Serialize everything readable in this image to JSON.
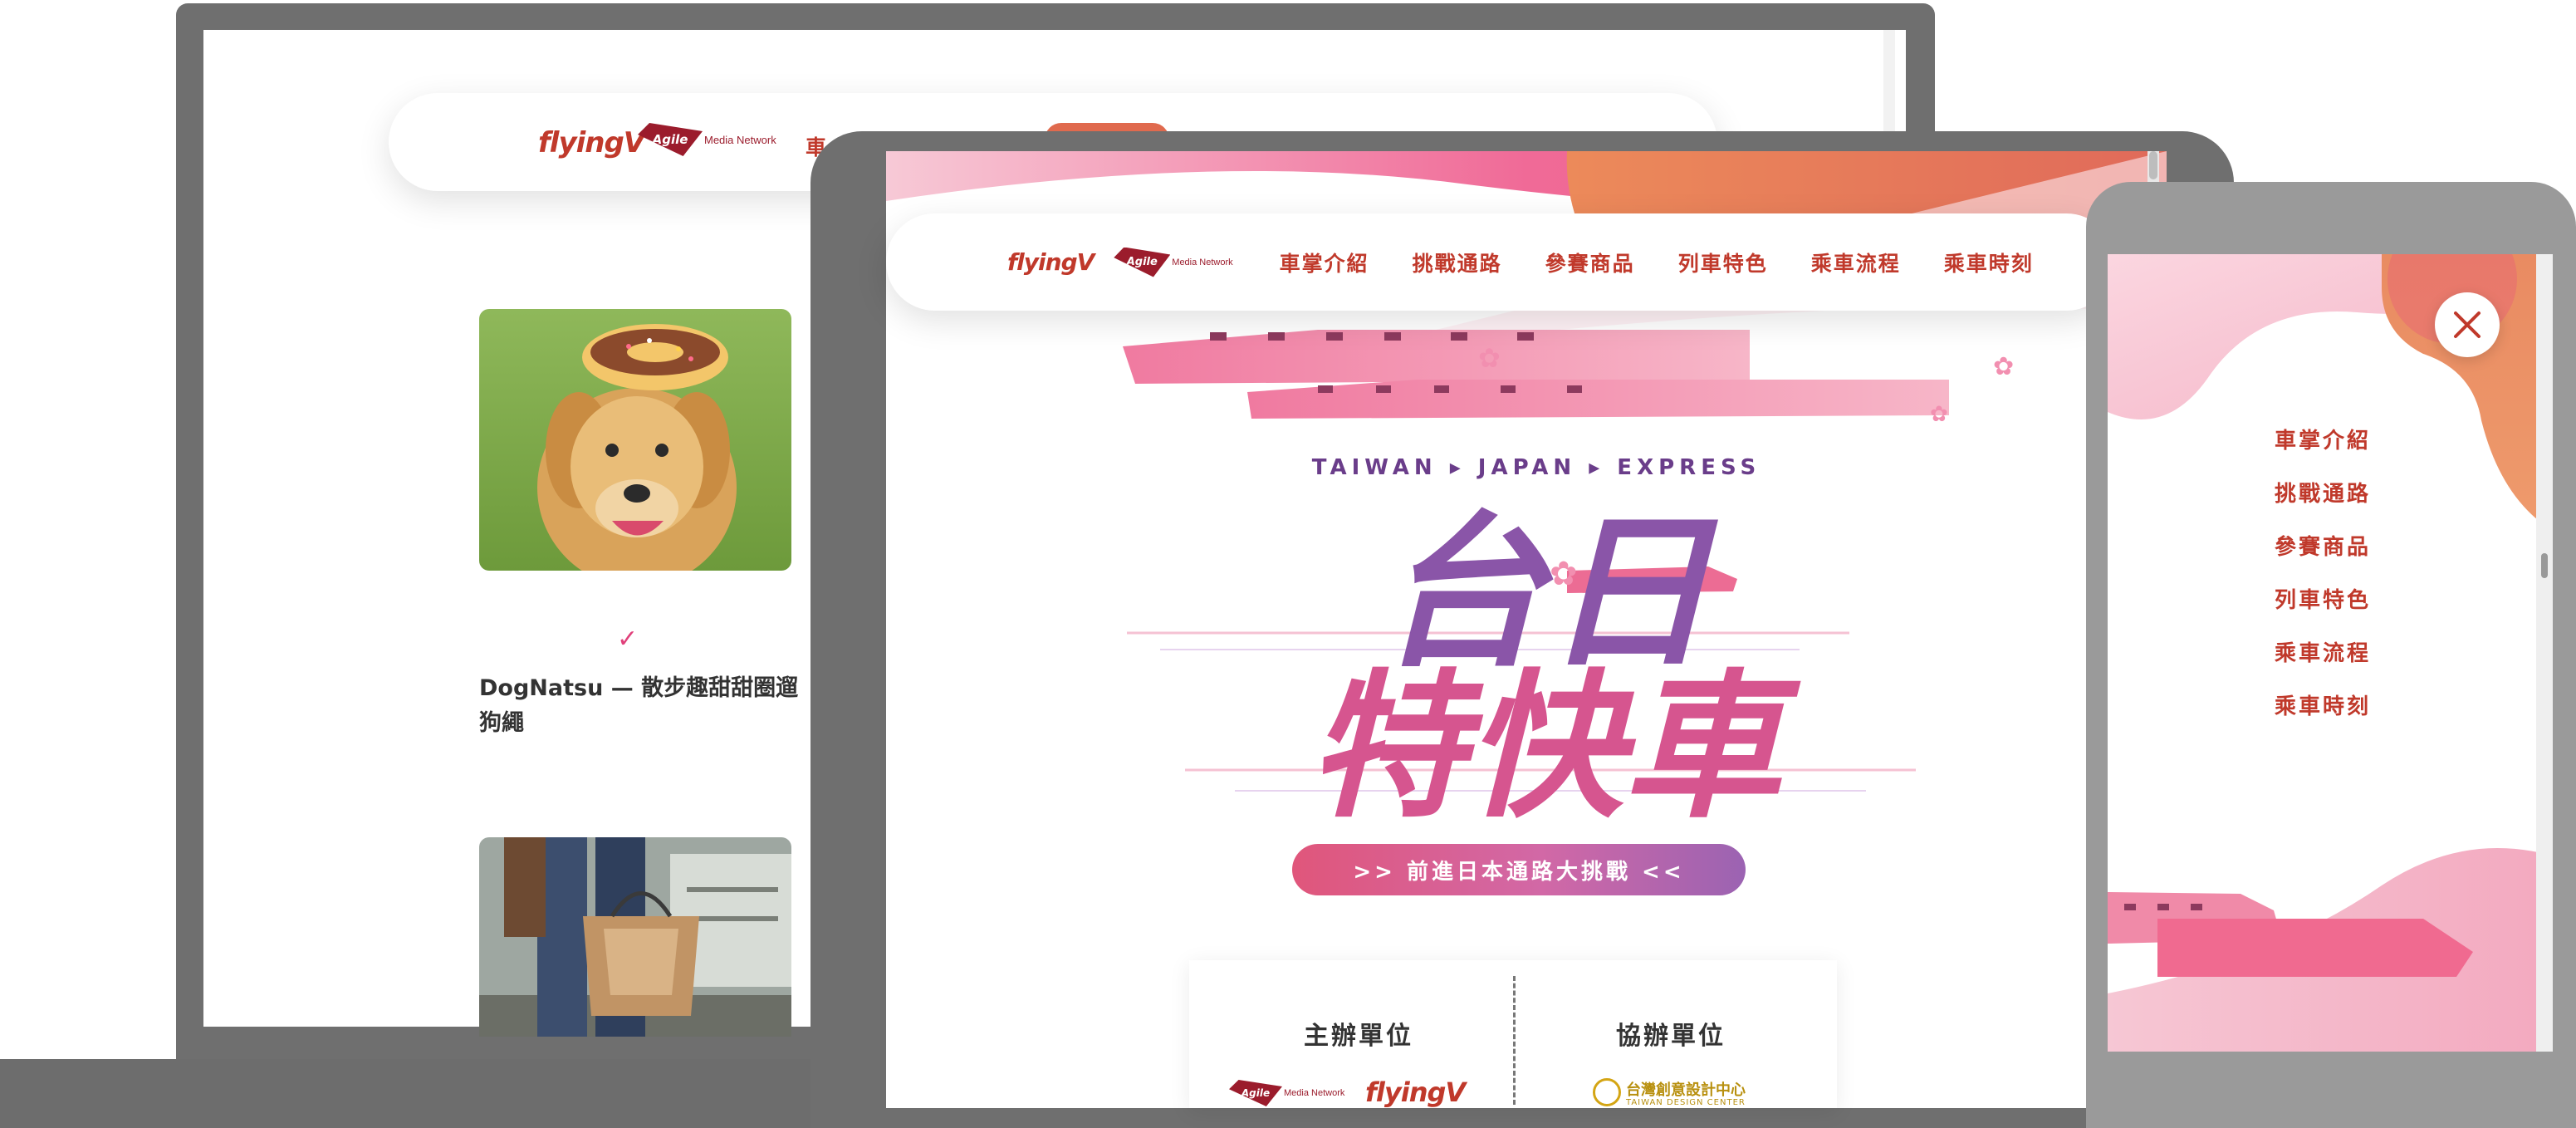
{
  "brand": {
    "flyingv": "flyingV",
    "agile_mark": "Agile",
    "agile_network": "Media Network"
  },
  "nav": {
    "items": [
      "車掌介紹",
      "挑戰通路",
      "參賽商品",
      "列車特色",
      "乘車流程",
      "乘車時刻"
    ]
  },
  "laptop": {
    "nav_partial_item": "車",
    "card": {
      "title": "DogNatsu — 散步趣甜甜圈遛狗繩"
    }
  },
  "hero": {
    "tagline": "TAIWAN ▸ JAPAN ▸ EXPRESS",
    "title_line1": "台日",
    "title_line2": "特快車",
    "pill": ">> 前進日本通路大挑戰 <<"
  },
  "organizers": {
    "host_label": "主辦單位",
    "co_label": "協辦單位",
    "co_org_name": "台灣創意設計中心",
    "co_org_name_en": "TAIWAN DESIGN CENTER"
  },
  "colors": {
    "brand_red": "#c0392b",
    "agile_red": "#9b1c2c",
    "title_purple": "#8a55a8",
    "title_pink": "#d6558f",
    "hero_orange": "#e88a5c"
  },
  "icons": [
    "close-icon",
    "sparkle-icon",
    "sakura-icon"
  ]
}
